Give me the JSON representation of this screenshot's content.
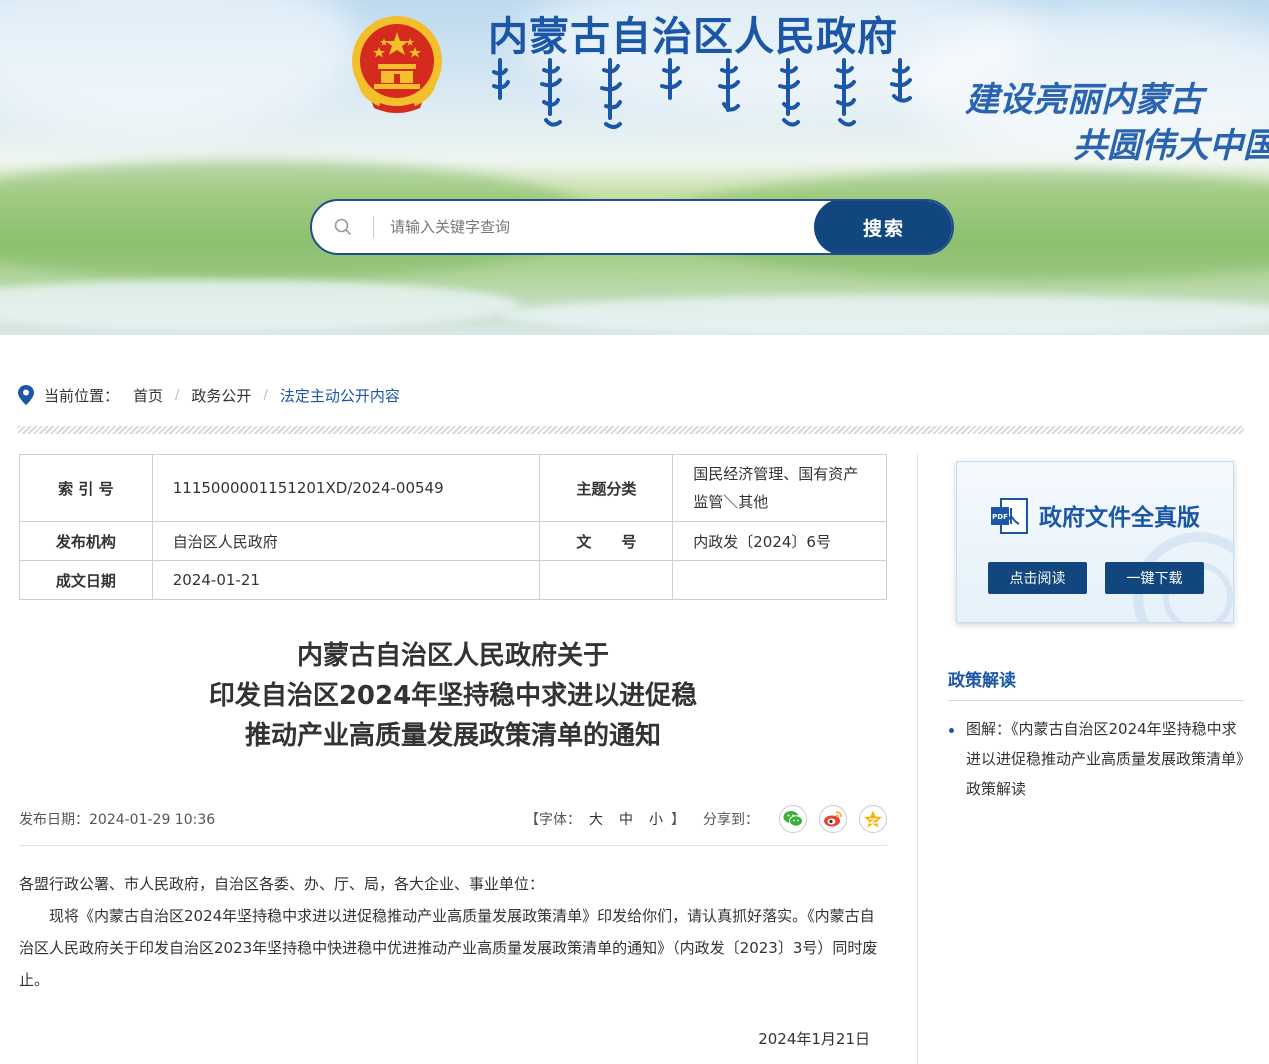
{
  "header": {
    "site_title": "内蒙古自治区人民政府",
    "slogan_line1": "建设亮丽内蒙古",
    "slogan_line2": "共圆伟大中国梦"
  },
  "search": {
    "placeholder": "请输入关键字查询",
    "value": "",
    "button_label": "搜索"
  },
  "breadcrumb": {
    "label": "当前位置：",
    "items": [
      "首页",
      "政务公开",
      "法定主动公开内容"
    ]
  },
  "meta": {
    "index_key": "索 引 号",
    "index_value": "1115000001151201XD/2024-00549",
    "topic_key": "主题分类",
    "topic_value": "国民经济管理、国有资产监管＼其他",
    "issuer_key": "发布机构",
    "issuer_value": "自治区人民政府",
    "doc_no_key": "文　　号",
    "doc_no_value": "内政发〔2024〕6号",
    "date_key": "成文日期",
    "date_value": "2024-01-21"
  },
  "article": {
    "title_line1": "内蒙古自治区人民政府关于",
    "title_line2": "印发自治区2024年坚持稳中求进以进促稳",
    "title_line3": "推动产业高质量发展政策清单的通知",
    "publish_date": "发布日期：2024-01-29 10:36",
    "font_label_open": "【字体：",
    "font_large": "大",
    "font_medium": "中",
    "font_small": "小",
    "font_label_close": "】",
    "share_label": "分享到：",
    "salutation": "各盟行政公署、市人民政府，自治区各委、办、厅、局，各大企业、事业单位：",
    "body": "现将《内蒙古自治区2024年坚持稳中求进以进促稳推动产业高质量发展政策清单》印发给你们，请认真抓好落实。《内蒙古自治区人民政府关于印发自治区2023年坚持稳中快进稳中优进推动产业高质量发展政策清单的通知》（内政发〔2023〕3号）同时废止。",
    "sign_date": "2024年1月21日"
  },
  "sidebar": {
    "doc_card_title": "政府文件全真版",
    "read_button": "点击阅读",
    "download_button": "一键下载",
    "policy_heading": "政策解读",
    "policy_items": [
      "图解：《内蒙古自治区2024年坚持稳中求进以进促稳推动产业高质量发展政策清单》政策解读"
    ]
  },
  "icons": {
    "search": "search-icon",
    "location": "location-pin-icon",
    "wechat": "wechat-icon",
    "weibo": "weibo-icon",
    "qzone": "qzone-star-icon",
    "pdf": "pdf-document-icon",
    "emblem": "national-emblem-icon"
  },
  "colors": {
    "brand_blue": "#1b57a6",
    "button_navy": "#12467f",
    "wechat_green": "#3bb13b",
    "weibo_red": "#e6452b",
    "qzone_yellow": "#f5b400",
    "emblem_red": "#d42b1e",
    "emblem_gold": "#f3c02c"
  }
}
